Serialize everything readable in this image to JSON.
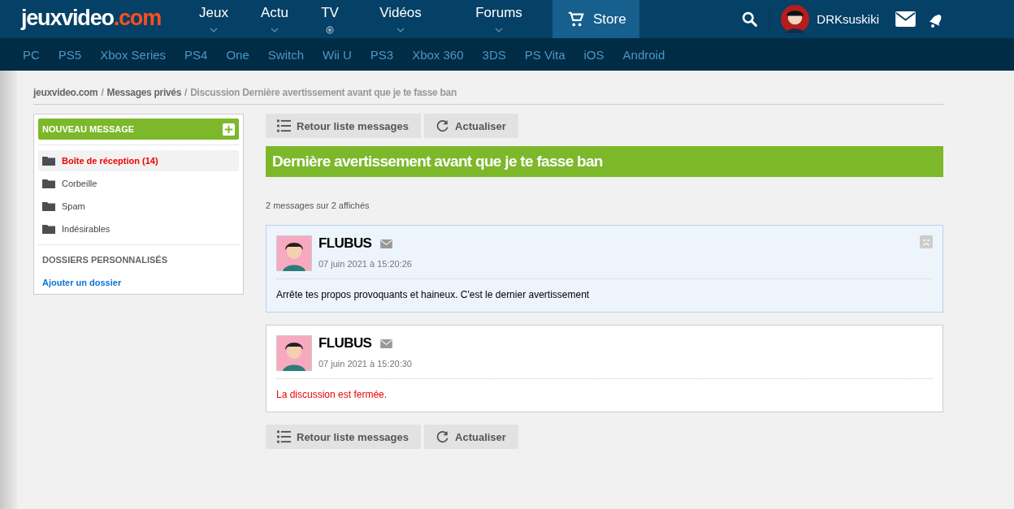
{
  "header": {
    "logo": {
      "main": "jeuxvideo",
      "suffix": ".com"
    },
    "nav": [
      {
        "label": "Jeux",
        "kind": "caret",
        "selected": false
      },
      {
        "label": "Actu",
        "kind": "caret",
        "selected": false
      },
      {
        "label": "TV",
        "kind": "dot",
        "selected": false
      },
      {
        "label": "Vidéos",
        "kind": "caret",
        "selected": false
      },
      {
        "label": "Forums",
        "kind": "caret",
        "selected": false
      },
      {
        "label": "Store",
        "kind": "cart",
        "selected": true
      }
    ],
    "username": "DRKsuskiki"
  },
  "platforms": [
    "PC",
    "PS5",
    "Xbox Series",
    "PS4",
    "One",
    "Switch",
    "Wii U",
    "PS3",
    "Xbox 360",
    "3DS",
    "PS Vita",
    "iOS",
    "Android"
  ],
  "breadcrumb": [
    {
      "label": "jeuxvideo.com",
      "kind": "link"
    },
    {
      "separator": "/",
      "label": "Messages privés",
      "kind": "link"
    },
    {
      "separator": "/",
      "label": "Discussion Dernière avertissement avant que je te fasse ban",
      "kind": "current"
    }
  ],
  "sidebar": {
    "new_message": "NOUVEAU MESSAGE",
    "folders": [
      {
        "label": "Boîte de réception (14)",
        "selected": true
      },
      {
        "label": "Corbeille",
        "selected": false
      },
      {
        "label": "Spam",
        "selected": false
      },
      {
        "label": "Indésirables",
        "selected": false
      }
    ],
    "custom_heading": "DOSSIERS PERSONNALISÉS",
    "add_folder": "Ajouter un dossier"
  },
  "toolbar": {
    "back": "Retour liste messages",
    "refresh": "Actualiser"
  },
  "discussion_title": "Dernière avertissement avant que je te fasse ban",
  "count": "2 messages sur 2 affichés",
  "messages": [
    {
      "author": "FLUBUS",
      "date": "07 juin 2021 à 15:20:26",
      "body": "Arrête tes propos provoquants et haineux. C'est le dernier avertissement",
      "kind": "post",
      "highlighted": true,
      "reportable": true
    },
    {
      "author": "FLUBUS",
      "date": "07 juin 2021 à 15:20:30",
      "body": "La discussion est fermée.",
      "kind": "system",
      "highlighted": false,
      "reportable": false
    }
  ],
  "bottom_toolbar": {
    "back": "Retour liste messages",
    "refresh": "Actualiser"
  }
}
